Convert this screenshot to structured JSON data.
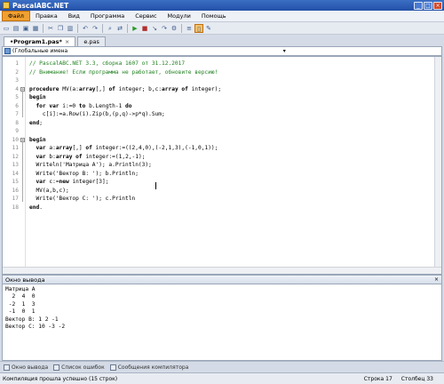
{
  "window": {
    "title": "PascalABC.NET"
  },
  "menu": [
    "Файл",
    "Правка",
    "Вид",
    "Программа",
    "Сервис",
    "Модули",
    "Помощь"
  ],
  "toolbar": {
    "icons": [
      "new-file-icon",
      "open-icon",
      "save-icon",
      "save-all-icon",
      "cut-icon",
      "copy-icon",
      "paste-icon",
      "undo-icon",
      "redo-icon",
      "find-icon",
      "replace-icon",
      "run-icon",
      "stop-icon",
      "step-into-icon",
      "step-over-icon",
      "debug-icon",
      "format-icon",
      "output-icon",
      "settings-icon"
    ]
  },
  "tabs": [
    {
      "label": "•Program1.pas*",
      "active": true,
      "close": "×"
    },
    {
      "label": "e.pas",
      "active": false,
      "close": ""
    }
  ],
  "scope": {
    "text": "(Глобальные имена"
  },
  "editor": {
    "lines": [
      {
        "n": "1",
        "html": "<span class='cm'>// PascalABC.NET 3.3, сборка 1607 от 31.12.2017</span>"
      },
      {
        "n": "2",
        "html": "<span class='cm'>// Внимание! Если программа не работает, обновите версию!</span>"
      },
      {
        "n": "3",
        "html": ""
      },
      {
        "n": "4",
        "html": "<span class='kw'>procedure</span> MV(a:<span class='kw'>array</span>[,] <span class='kw'>of</span> integer; b,c:<span class='kw'>array of</span> integer);"
      },
      {
        "n": "5",
        "html": "<span class='kw'>begin</span>"
      },
      {
        "n": "6",
        "html": "  <span class='kw'>for var</span> i:=0 <span class='kw'>to</span> b.Length-1 <span class='kw'>do</span>"
      },
      {
        "n": "7",
        "html": "    c[i]:=a.Row(i).Zip(b,(p,q)->p*q).Sum;"
      },
      {
        "n": "8",
        "html": "<span class='kw'>end</span>;"
      },
      {
        "n": "9",
        "html": ""
      },
      {
        "n": "10",
        "html": "<span class='kw'>begin</span>"
      },
      {
        "n": "11",
        "html": "  <span class='kw'>var</span> a:<span class='kw'>array</span>[,] <span class='kw'>of</span> integer:=((2,4,0),(-2,1,3),(-1,0,1));"
      },
      {
        "n": "12",
        "html": "  <span class='kw'>var</span> b:<span class='kw'>array of</span> integer:=(1,2,-1);"
      },
      {
        "n": "13",
        "html": "  Writeln('Матрица А'); a.Println(3);"
      },
      {
        "n": "14",
        "html": "  Write('Вектор B: '); b.Println;"
      },
      {
        "n": "15",
        "html": "  <span class='kw'>var</span> c:=<span class='kw'>new</span> integer[3];"
      },
      {
        "n": "16",
        "html": "  MV(a,b,c);"
      },
      {
        "n": "17",
        "html": "  Write('Вектор C: '); c.Println"
      },
      {
        "n": "18",
        "html": "<span class='kw'>end</span>."
      }
    ]
  },
  "output": {
    "title": "Окно вывода",
    "close": "×",
    "text": "Матрица А\n  2  4  0\n -2  1  3\n -1  0  1\nВектор B: 1 2 -1\nВектор C: 10 -3 -2"
  },
  "bottom_tabs": [
    "Окно вывода",
    "Список ошибок",
    "Сообщения компилятора"
  ],
  "status": {
    "message": "Компиляция прошла успешно (15 строк)",
    "row_label": "Строка",
    "row": "17",
    "col_label": "Столбец",
    "col": "33"
  }
}
